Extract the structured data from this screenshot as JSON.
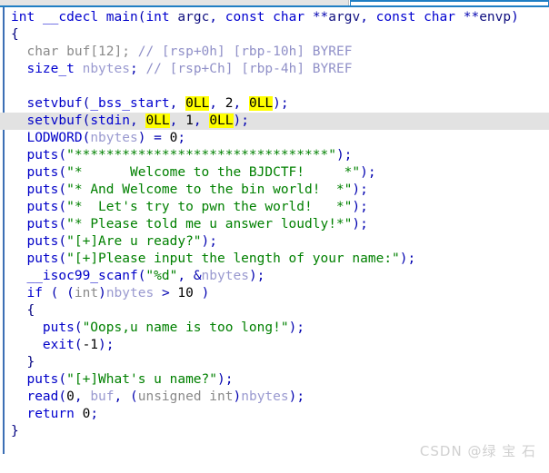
{
  "window": {
    "app": "IDA Pro Pseudocode View",
    "tab_strip": {
      "inactive_tab_label": "",
      "active_tab_label": "",
      "accent_color": "#1f7ec4"
    }
  },
  "theme": {
    "background": "#ffffff",
    "keyword_color": "#0000d0",
    "string_color": "#008000",
    "comment_color": "#9090c8",
    "variable_color": "#9a9ad0",
    "type_color": "#8a8a8a",
    "current_line_highlight": "#e2e2e2",
    "search_highlight": "#ffff00",
    "fold_bar_color": "#3c6fb5"
  },
  "code": {
    "language": "c-pseudocode",
    "highlighted_line_index": 9,
    "highlighted_tokens": [
      "0LL"
    ],
    "lines": [
      {
        "i": 0,
        "text": "int __cdecl main(int argc, const char **argv, const char **envp)"
      },
      {
        "i": 1,
        "text": "{"
      },
      {
        "i": 2,
        "text": "  char buf[12]; // [rsp+0h] [rbp-10h] BYREF"
      },
      {
        "i": 3,
        "text": "  size_t nbytes; // [rsp+Ch] [rbp-4h] BYREF"
      },
      {
        "i": 4,
        "text": ""
      },
      {
        "i": 5,
        "text": "  setvbuf(_bss_start, 0LL, 2, 0LL);"
      },
      {
        "i": 6,
        "text": "  setvbuf(stdin, 0LL, 1, 0LL);"
      },
      {
        "i": 7,
        "text": "  LODWORD(nbytes) = 0;"
      },
      {
        "i": 8,
        "text": "  puts(\"********************************\");"
      },
      {
        "i": 9,
        "text": "  puts(\"*      Welcome to the BJDCTF!     *\");"
      },
      {
        "i": 10,
        "text": "  puts(\"* And Welcome to the bin world!  *\");"
      },
      {
        "i": 11,
        "text": "  puts(\"*  Let's try to pwn the world!   *\");"
      },
      {
        "i": 12,
        "text": "  puts(\"* Please told me u answer loudly!*\");"
      },
      {
        "i": 13,
        "text": "  puts(\"[+]Are u ready?\");"
      },
      {
        "i": 14,
        "text": "  puts(\"[+]Please input the length of your name:\");"
      },
      {
        "i": 15,
        "text": "  __isoc99_scanf(\"%d\", &nbytes);"
      },
      {
        "i": 16,
        "text": "  if ( (int)nbytes > 10 )"
      },
      {
        "i": 17,
        "text": "  {"
      },
      {
        "i": 18,
        "text": "    puts(\"Oops,u name is too long!\");"
      },
      {
        "i": 19,
        "text": "    exit(-1);"
      },
      {
        "i": 20,
        "text": "  }"
      },
      {
        "i": 21,
        "text": "  puts(\"[+]What's u name?\");"
      },
      {
        "i": 22,
        "text": "  read(0, buf, (unsigned int)nbytes);"
      },
      {
        "i": 23,
        "text": "  return 0;"
      },
      {
        "i": 24,
        "text": "}"
      }
    ]
  },
  "watermark": {
    "text": "CSDN @绿 宝 石"
  }
}
